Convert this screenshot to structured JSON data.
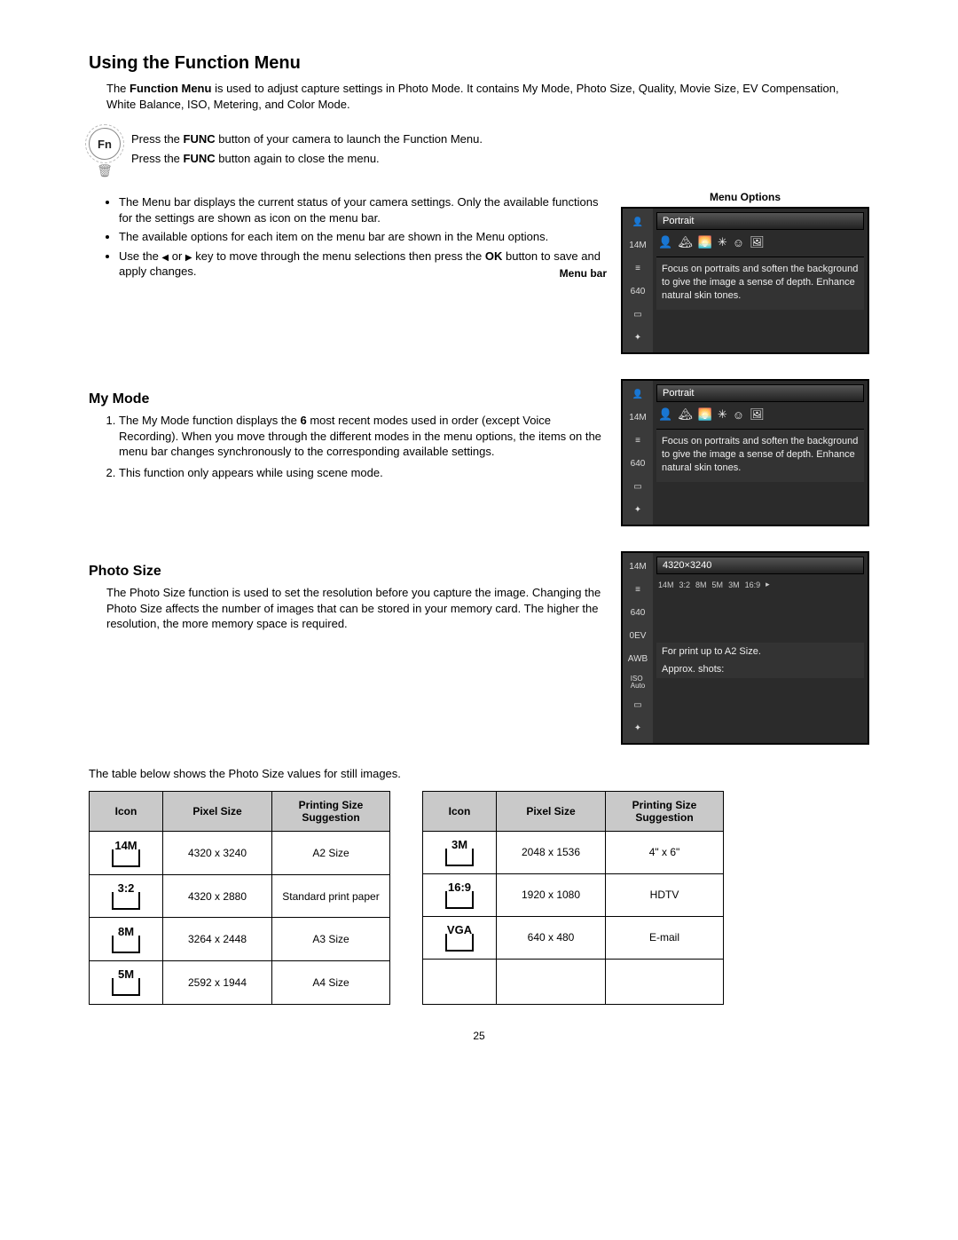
{
  "page_number": "25",
  "title": "Using the Function Menu",
  "intro_prefix": "The ",
  "intro_bold": "Function Menu",
  "intro_suffix": " is used to adjust capture settings in Photo Mode. It contains My Mode, Photo Size, Quality, Movie Size, EV Compensation, White Balance, ISO, Metering, and Color Mode.",
  "fn_label": "Fn",
  "fn_line1a": "Press the ",
  "fn_line1b": "FUNC",
  "fn_line1c": " button of your camera to launch the Function Menu.",
  "fn_line2a": "Press the ",
  "fn_line2b": "FUNC",
  "fn_line2c": " button again to close the menu.",
  "bullets": {
    "b1": "The Menu bar displays the current status of your camera settings. Only the available functions for the settings are shown as icon on the menu bar.",
    "b2": "The available options for each item on the menu bar are shown in the Menu options.",
    "b3a": "Use the ",
    "b3b": " or ",
    "b3c": " key to move through the menu selections then press the ",
    "b3ok": "OK",
    "b3d": " button to save and apply changes."
  },
  "labels": {
    "menu_bar": "Menu bar",
    "menu_options": "Menu Options"
  },
  "lcd1": {
    "title": "Portrait",
    "desc": "Focus on portraits and soften the background to give the image a sense of depth. Enhance natural skin tones.",
    "side": [
      "👤",
      "14M",
      "⬇",
      "640",
      "▭",
      "✦"
    ]
  },
  "my_mode": {
    "heading": "My Mode",
    "p1a": "The My Mode function displays the ",
    "p1b": "6",
    "p1c": " most recent modes used in order (except Voice Recording). When you move through the different modes in the menu options, the items on the menu bar changes synchronously to the corresponding available settings.",
    "p2": "This function only appears while using scene mode."
  },
  "photo_size": {
    "heading": "Photo Size",
    "p": "The Photo Size function is used to set the resolution before you capture the image. Changing the Photo Size affects the number of images that can be stored in your memory card. The higher the resolution, the more memory space is required.",
    "table_intro": "The table below shows the Photo Size values for still images."
  },
  "lcd3": {
    "title": "4320×3240",
    "options": [
      "14M",
      "3:2",
      "8M",
      "5M",
      "3M",
      "16:9"
    ],
    "desc1": "For print up to A2 Size.",
    "desc2": "Approx. shots:",
    "side": [
      "14M",
      "⬇",
      "640",
      "0EV",
      "AWB",
      "ISO Auto",
      "▭",
      "✦"
    ]
  },
  "table_headers": {
    "icon": "Icon",
    "pixel": "Pixel Size",
    "print": "Printing Size Suggestion"
  },
  "table_left": [
    {
      "icon": "14M",
      "px": "4320 x 3240",
      "pr": "A2 Size"
    },
    {
      "icon": "3:2",
      "px": "4320  x 2880",
      "pr": "Standard print paper"
    },
    {
      "icon": "8M",
      "px": "3264 x 2448",
      "pr": "A3 Size"
    },
    {
      "icon": "5M",
      "px": "2592 x 1944",
      "pr": "A4 Size"
    }
  ],
  "table_right": [
    {
      "icon": "3M",
      "px": "2048 x 1536",
      "pr": "4\" x 6\""
    },
    {
      "icon": "16:9",
      "px": "1920 x 1080",
      "pr": "HDTV"
    },
    {
      "icon": "VGA",
      "px": "640 x 480",
      "pr": "E-mail"
    },
    {
      "icon": "",
      "px": "",
      "pr": ""
    }
  ]
}
